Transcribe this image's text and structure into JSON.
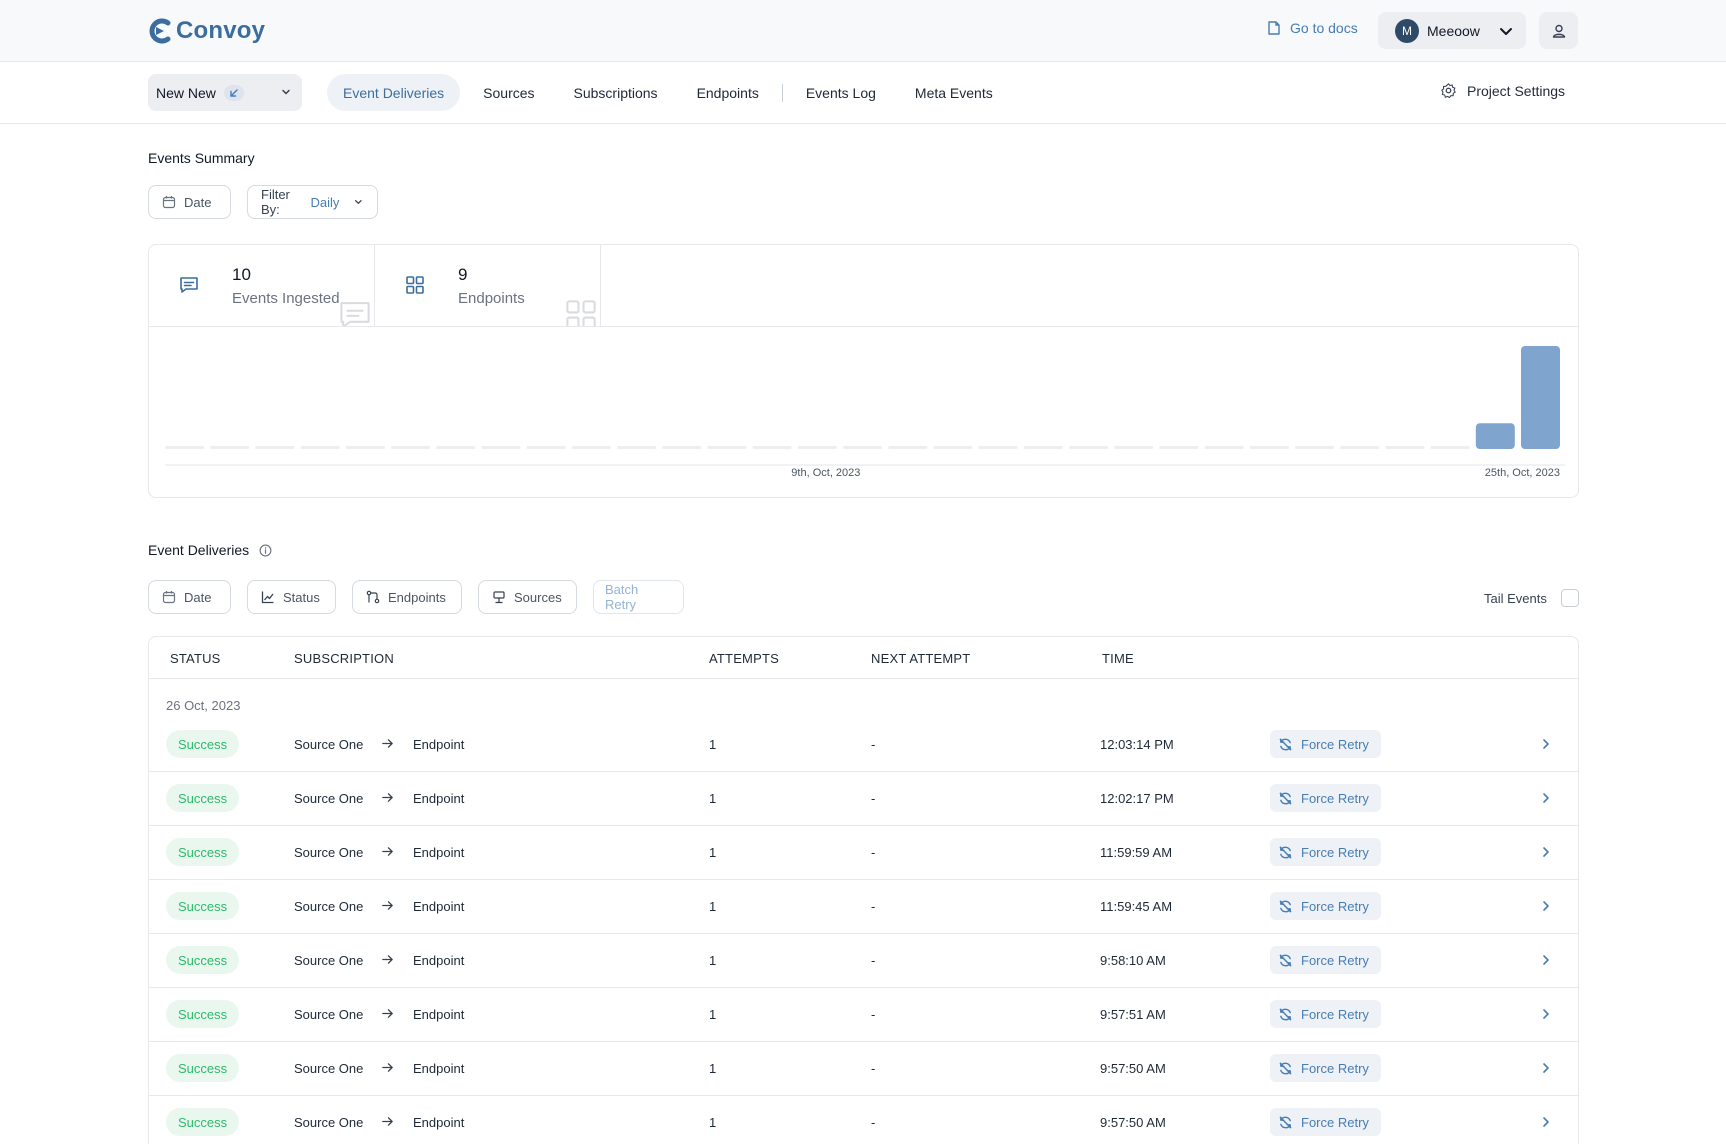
{
  "header": {
    "logo_text": "Convoy",
    "docs_label": "Go to docs",
    "user": {
      "initial": "M",
      "name": "Meeoow"
    }
  },
  "nav": {
    "project_name": "New New",
    "tabs": [
      {
        "label": "Event Deliveries",
        "active": true
      },
      {
        "label": "Sources",
        "active": false
      },
      {
        "label": "Subscriptions",
        "active": false
      },
      {
        "label": "Endpoints",
        "active": false
      },
      {
        "label": "Events Log",
        "active": false
      },
      {
        "label": "Meta Events",
        "active": false
      }
    ],
    "settings_label": "Project Settings"
  },
  "summary": {
    "title": "Events Summary",
    "date_label": "Date",
    "filter_prefix": "Filter By:",
    "filter_value": "Daily",
    "stats": [
      {
        "value": "10",
        "label": "Events Ingested",
        "icon": "chat-icon"
      },
      {
        "value": "9",
        "label": "Endpoints",
        "icon": "grid-icon"
      }
    ]
  },
  "chart_data": {
    "type": "bar",
    "series_color": "#7fa5cf",
    "values": [
      0,
      0,
      0,
      0,
      0,
      0,
      0,
      0,
      0,
      0,
      0,
      0,
      0,
      0,
      0,
      0,
      0,
      0,
      0,
      0,
      0,
      0,
      0,
      0,
      0,
      0,
      0,
      0,
      0,
      2,
      8
    ],
    "ylim": [
      0,
      8
    ],
    "tick_labels": [
      {
        "index": 14,
        "label": "9th, Oct, 2023"
      },
      {
        "index": 30,
        "label": "25th, Oct, 2023"
      }
    ]
  },
  "deliveries": {
    "title": "Event Deliveries",
    "filters": {
      "date": "Date",
      "status": "Status",
      "endpoints": "Endpoints",
      "sources": "Sources",
      "batch_retry": "Batch Retry"
    },
    "tail_label": "Tail Events",
    "columns": {
      "status": "STATUS",
      "subscription": "SUBSCRIPTION",
      "attempts": "ATTEMPTS",
      "next_attempt": "NEXT ATTEMPT",
      "time": "TIME"
    },
    "date_group": "26 Oct, 2023",
    "retry_label": "Force Retry",
    "rows": [
      {
        "status": "Success",
        "source": "Source One",
        "endpoint": "Endpoint",
        "attempts": "1",
        "next_attempt": "-",
        "time": "12:03:14 PM"
      },
      {
        "status": "Success",
        "source": "Source One",
        "endpoint": "Endpoint",
        "attempts": "1",
        "next_attempt": "-",
        "time": "12:02:17 PM"
      },
      {
        "status": "Success",
        "source": "Source One",
        "endpoint": "Endpoint",
        "attempts": "1",
        "next_attempt": "-",
        "time": "11:59:59 AM"
      },
      {
        "status": "Success",
        "source": "Source One",
        "endpoint": "Endpoint",
        "attempts": "1",
        "next_attempt": "-",
        "time": "11:59:45 AM"
      },
      {
        "status": "Success",
        "source": "Source One",
        "endpoint": "Endpoint",
        "attempts": "1",
        "next_attempt": "-",
        "time": "9:58:10 AM"
      },
      {
        "status": "Success",
        "source": "Source One",
        "endpoint": "Endpoint",
        "attempts": "1",
        "next_attempt": "-",
        "time": "9:57:51 AM"
      },
      {
        "status": "Success",
        "source": "Source One",
        "endpoint": "Endpoint",
        "attempts": "1",
        "next_attempt": "-",
        "time": "9:57:50 AM"
      },
      {
        "status": "Success",
        "source": "Source One",
        "endpoint": "Endpoint",
        "attempts": "1",
        "next_attempt": "-",
        "time": "9:57:50 AM"
      }
    ]
  }
}
